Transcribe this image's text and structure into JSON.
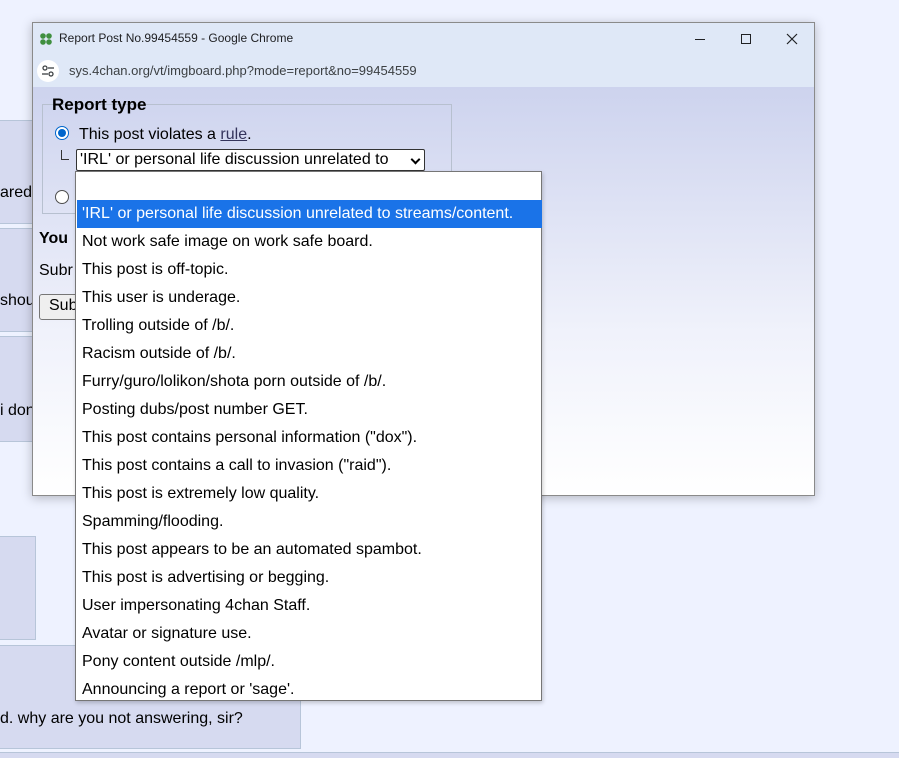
{
  "window": {
    "title": "Report Post No.99454559 - Google Chrome",
    "url": "sys.4chan.org/vt/imgboard.php?mode=report&no=99454559",
    "icon": "clover-icon"
  },
  "form": {
    "legend": "Report type",
    "rule_prefix": "This post violates a ",
    "rule_link": "rule",
    "rule_suffix": ".",
    "selected_rule": "'IRL' or personal life discussion unrelated to",
    "you_partial": "You",
    "submit_text_partial": "Subr",
    "submit_button_partial": "Sub"
  },
  "dropdown": {
    "options": [
      "",
      "'IRL' or personal life discussion unrelated to streams/content.",
      "Not work safe image on work safe board.",
      "This post is off-topic.",
      "This user is underage.",
      "Trolling outside of /b/.",
      "Racism outside of /b/.",
      "Furry/guro/lolikon/shota porn outside of /b/.",
      "Posting dubs/post number GET.",
      "This post contains personal information (\"dox\").",
      "This post contains a call to invasion (\"raid\").",
      "This post is extremely low quality.",
      "Spamming/flooding.",
      "This post appears to be an automated spambot.",
      "This post is advertising or begging.",
      "User impersonating 4chan Staff.",
      "Avatar or signature use.",
      "Pony content outside /mlp/.",
      "Announcing a report or 'sage'."
    ]
  },
  "background": {
    "text1": "ared c",
    "text2": "shoul",
    "text3": "i don",
    "text4": "d. why are you not answering, sir?"
  },
  "colors": {
    "selected_option": "#1a73e8",
    "radio_checked": "#0066cc",
    "board_bg": "#eef2ff",
    "post_bg": "#d6daf0"
  }
}
